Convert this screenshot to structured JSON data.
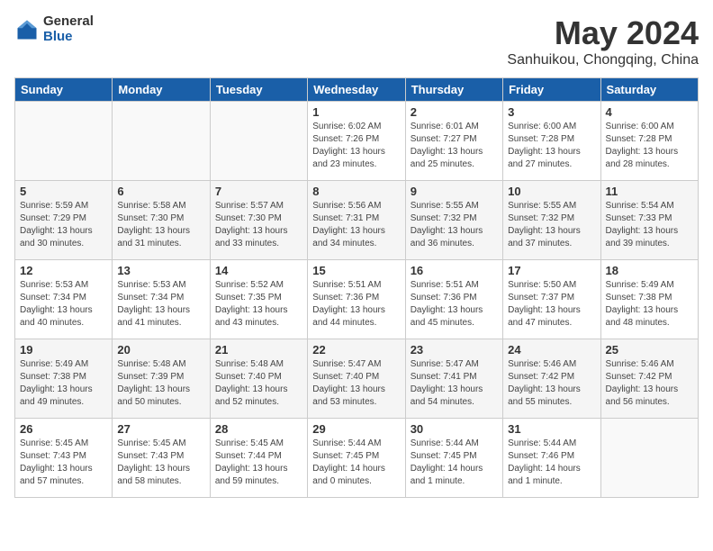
{
  "header": {
    "logo_general": "General",
    "logo_blue": "Blue",
    "month_title": "May 2024",
    "location": "Sanhuikou, Chongqing, China"
  },
  "days_of_week": [
    "Sunday",
    "Monday",
    "Tuesday",
    "Wednesday",
    "Thursday",
    "Friday",
    "Saturday"
  ],
  "weeks": [
    [
      {
        "day": "",
        "info": ""
      },
      {
        "day": "",
        "info": ""
      },
      {
        "day": "",
        "info": ""
      },
      {
        "day": "1",
        "info": "Sunrise: 6:02 AM\nSunset: 7:26 PM\nDaylight: 13 hours\nand 23 minutes."
      },
      {
        "day": "2",
        "info": "Sunrise: 6:01 AM\nSunset: 7:27 PM\nDaylight: 13 hours\nand 25 minutes."
      },
      {
        "day": "3",
        "info": "Sunrise: 6:00 AM\nSunset: 7:28 PM\nDaylight: 13 hours\nand 27 minutes."
      },
      {
        "day": "4",
        "info": "Sunrise: 6:00 AM\nSunset: 7:28 PM\nDaylight: 13 hours\nand 28 minutes."
      }
    ],
    [
      {
        "day": "5",
        "info": "Sunrise: 5:59 AM\nSunset: 7:29 PM\nDaylight: 13 hours\nand 30 minutes."
      },
      {
        "day": "6",
        "info": "Sunrise: 5:58 AM\nSunset: 7:30 PM\nDaylight: 13 hours\nand 31 minutes."
      },
      {
        "day": "7",
        "info": "Sunrise: 5:57 AM\nSunset: 7:30 PM\nDaylight: 13 hours\nand 33 minutes."
      },
      {
        "day": "8",
        "info": "Sunrise: 5:56 AM\nSunset: 7:31 PM\nDaylight: 13 hours\nand 34 minutes."
      },
      {
        "day": "9",
        "info": "Sunrise: 5:55 AM\nSunset: 7:32 PM\nDaylight: 13 hours\nand 36 minutes."
      },
      {
        "day": "10",
        "info": "Sunrise: 5:55 AM\nSunset: 7:32 PM\nDaylight: 13 hours\nand 37 minutes."
      },
      {
        "day": "11",
        "info": "Sunrise: 5:54 AM\nSunset: 7:33 PM\nDaylight: 13 hours\nand 39 minutes."
      }
    ],
    [
      {
        "day": "12",
        "info": "Sunrise: 5:53 AM\nSunset: 7:34 PM\nDaylight: 13 hours\nand 40 minutes."
      },
      {
        "day": "13",
        "info": "Sunrise: 5:53 AM\nSunset: 7:34 PM\nDaylight: 13 hours\nand 41 minutes."
      },
      {
        "day": "14",
        "info": "Sunrise: 5:52 AM\nSunset: 7:35 PM\nDaylight: 13 hours\nand 43 minutes."
      },
      {
        "day": "15",
        "info": "Sunrise: 5:51 AM\nSunset: 7:36 PM\nDaylight: 13 hours\nand 44 minutes."
      },
      {
        "day": "16",
        "info": "Sunrise: 5:51 AM\nSunset: 7:36 PM\nDaylight: 13 hours\nand 45 minutes."
      },
      {
        "day": "17",
        "info": "Sunrise: 5:50 AM\nSunset: 7:37 PM\nDaylight: 13 hours\nand 47 minutes."
      },
      {
        "day": "18",
        "info": "Sunrise: 5:49 AM\nSunset: 7:38 PM\nDaylight: 13 hours\nand 48 minutes."
      }
    ],
    [
      {
        "day": "19",
        "info": "Sunrise: 5:49 AM\nSunset: 7:38 PM\nDaylight: 13 hours\nand 49 minutes."
      },
      {
        "day": "20",
        "info": "Sunrise: 5:48 AM\nSunset: 7:39 PM\nDaylight: 13 hours\nand 50 minutes."
      },
      {
        "day": "21",
        "info": "Sunrise: 5:48 AM\nSunset: 7:40 PM\nDaylight: 13 hours\nand 52 minutes."
      },
      {
        "day": "22",
        "info": "Sunrise: 5:47 AM\nSunset: 7:40 PM\nDaylight: 13 hours\nand 53 minutes."
      },
      {
        "day": "23",
        "info": "Sunrise: 5:47 AM\nSunset: 7:41 PM\nDaylight: 13 hours\nand 54 minutes."
      },
      {
        "day": "24",
        "info": "Sunrise: 5:46 AM\nSunset: 7:42 PM\nDaylight: 13 hours\nand 55 minutes."
      },
      {
        "day": "25",
        "info": "Sunrise: 5:46 AM\nSunset: 7:42 PM\nDaylight: 13 hours\nand 56 minutes."
      }
    ],
    [
      {
        "day": "26",
        "info": "Sunrise: 5:45 AM\nSunset: 7:43 PM\nDaylight: 13 hours\nand 57 minutes."
      },
      {
        "day": "27",
        "info": "Sunrise: 5:45 AM\nSunset: 7:43 PM\nDaylight: 13 hours\nand 58 minutes."
      },
      {
        "day": "28",
        "info": "Sunrise: 5:45 AM\nSunset: 7:44 PM\nDaylight: 13 hours\nand 59 minutes."
      },
      {
        "day": "29",
        "info": "Sunrise: 5:44 AM\nSunset: 7:45 PM\nDaylight: 14 hours\nand 0 minutes."
      },
      {
        "day": "30",
        "info": "Sunrise: 5:44 AM\nSunset: 7:45 PM\nDaylight: 14 hours\nand 1 minute."
      },
      {
        "day": "31",
        "info": "Sunrise: 5:44 AM\nSunset: 7:46 PM\nDaylight: 14 hours\nand 1 minute."
      },
      {
        "day": "",
        "info": ""
      }
    ]
  ]
}
